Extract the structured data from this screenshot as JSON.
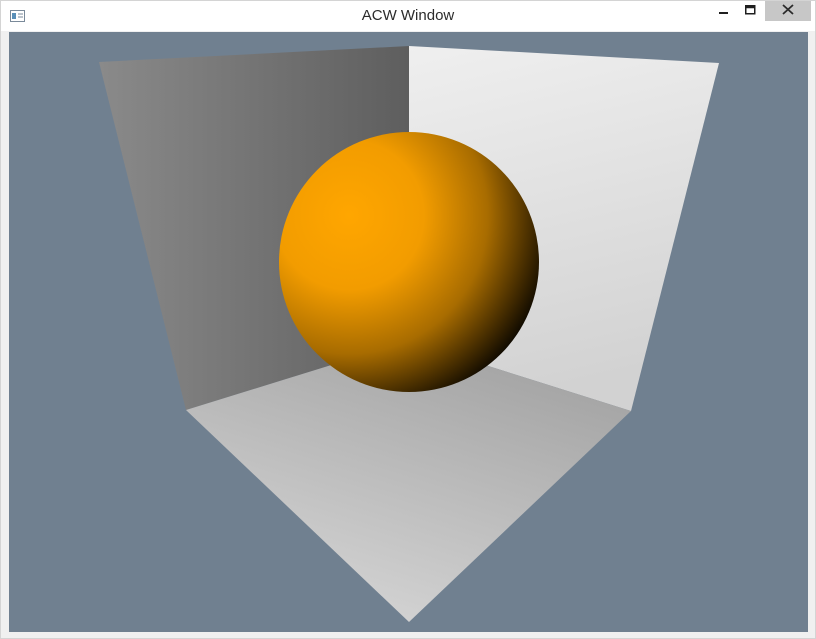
{
  "window": {
    "title": "ACW Window"
  },
  "icons": {
    "app": "window-app-icon",
    "minimize": "minimize-icon",
    "maximize": "maximize-icon",
    "close": "close-icon"
  },
  "scene": {
    "background_color": "#708090",
    "sphere_color": "#ffa500",
    "left_wall_color": "#6e6e6e",
    "right_wall_color": "#e4e4e4",
    "floor_color": "#bdbdbd"
  }
}
